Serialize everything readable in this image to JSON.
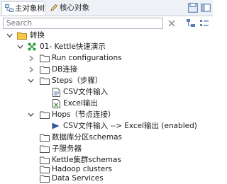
{
  "tabs": [
    {
      "label": "主对象树",
      "active": true
    },
    {
      "label": "核心对象",
      "active": false
    }
  ],
  "search": {
    "placeholder": "Search"
  },
  "tree": {
    "root": "转换",
    "transformation": "01- Kettle快速演示",
    "run_configurations": "Run configurations",
    "db_connections": "DB连接",
    "steps": "Steps（步骤）",
    "step_csv": "CSV文件输入",
    "step_excel": "Excel输出",
    "hops": "Hops（节点连接）",
    "hop_1": "CSV文件输入 --> Excel输出 (enabled)",
    "partition_schemas": "数据库分区schemas",
    "slave_servers": "子服务器",
    "cluster_schemas": "Kettle集群schemas",
    "hadoop_clusters": "Hadoop clusters",
    "data_services": "Data Services"
  },
  "colors": {
    "folder": "#f7c948",
    "accent": "#1f5aa6",
    "hop_arrow": "#2f5597",
    "spoon_green": "#2e9a3e"
  }
}
